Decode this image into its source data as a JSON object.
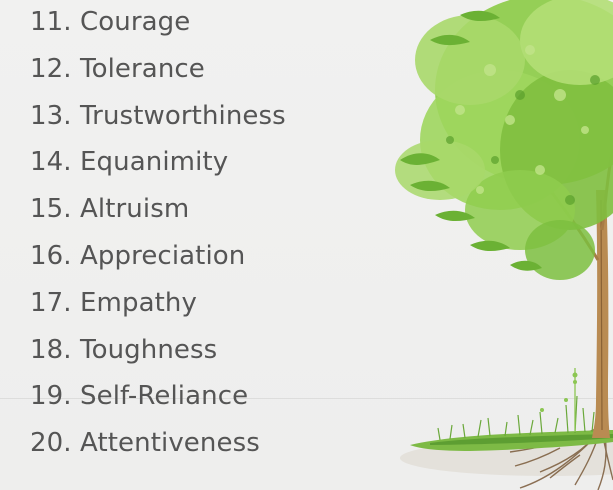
{
  "list": {
    "items": [
      "11. Courage",
      "12. Tolerance",
      "13. Trustworthiness",
      "14. Equanimity",
      "15. Altruism",
      "16. Appreciation",
      "17. Empathy",
      "18. Toughness",
      "19. Self-Reliance",
      "20. Attentiveness"
    ]
  },
  "illustration": {
    "icon": "tree-icon",
    "colors": {
      "foliage_light": "#a8d86a",
      "foliage_mid": "#7dbf3f",
      "foliage_dark": "#5aa02c",
      "trunk": "#b98b52",
      "trunk_dark": "#8a6235",
      "grass": "#6aa83a",
      "roots": "#7a5a3a"
    }
  }
}
